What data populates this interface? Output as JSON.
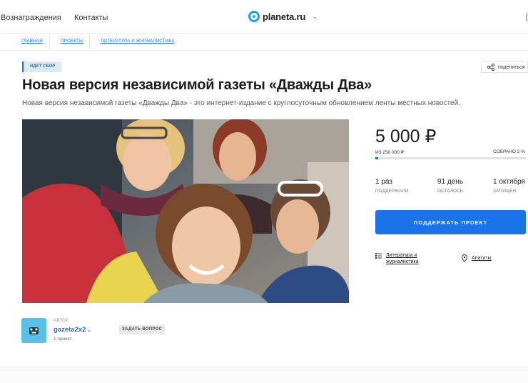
{
  "nav": {
    "links": [
      "Вознаграждения",
      "Контакты"
    ],
    "logo_text": "planeta.ru",
    "edge_text": "("
  },
  "breadcrumb": [
    "ГЛАВНАЯ",
    "ПРОЕКТЫ",
    "ЛИТЕРАТУРА И ЖУРНАЛИСТИКА"
  ],
  "project": {
    "status_badge": "ИДЕТ СБОР",
    "share_label": "поделиться",
    "title": "Новая версия независимой газеты «Дважды Два»",
    "description": "Новая версия независимой газеты «Дважды Два» - это интернет-издание с круглосуточным обновлением ленты местных новостей."
  },
  "funding": {
    "amount": "5 000 ₽",
    "goal": "ИЗ 250 000 ₽",
    "collected": "СОБРАНО 2 %",
    "progress_fraction": 0.02,
    "stats": [
      {
        "value": "1 раз",
        "label": "ПОДДЕРЖАЛИ"
      },
      {
        "value": "91 день",
        "label": "ОСТАЛОСЬ"
      },
      {
        "value": "1 октября",
        "label": "ЗАПУЩЕН"
      }
    ],
    "cta_label": "ПОДДЕРЖАТЬ ПРОЕКТ",
    "category": "Литература и журналистика",
    "location": "Апатиты"
  },
  "author": {
    "label": "АВТОР",
    "name": "gazeta2x2",
    "projects": "1 проект",
    "ask_label": "ЗАДАТЬ ВОПРОС"
  },
  "colors": {
    "accent": "#1a73e8",
    "logo": "#1aa3e8",
    "avatar": "#5bc0e8"
  }
}
